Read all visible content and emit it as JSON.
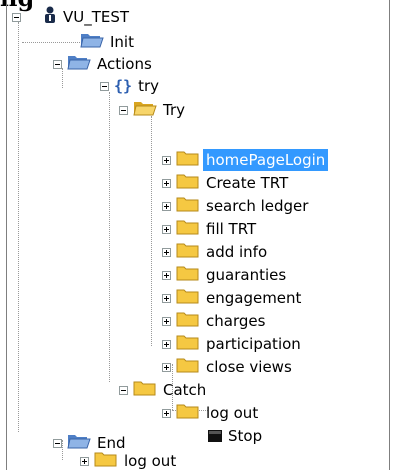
{
  "header": {
    "partial_title": "ng"
  },
  "tree": {
    "root": {
      "label": "VU_TEST",
      "icon": "user-icon"
    },
    "items": [
      {
        "label": "Init",
        "icon": "folder-open-icon"
      },
      {
        "label": "Actions",
        "icon": "folder-open-icon"
      },
      {
        "label": "try",
        "icon": "braces-icon"
      },
      {
        "label": "Try",
        "icon": "folder-open-icon"
      },
      {
        "label": "homePageLogin",
        "icon": "folder-icon",
        "selected": true
      },
      {
        "label": "Create TRT",
        "icon": "folder-icon"
      },
      {
        "label": "search ledger",
        "icon": "folder-icon"
      },
      {
        "label": "fill TRT",
        "icon": "folder-icon"
      },
      {
        "label": "add info",
        "icon": "folder-icon"
      },
      {
        "label": "guaranties",
        "icon": "folder-icon"
      },
      {
        "label": "engagement",
        "icon": "folder-icon"
      },
      {
        "label": "charges",
        "icon": "folder-icon"
      },
      {
        "label": "participation",
        "icon": "folder-icon"
      },
      {
        "label": "close views",
        "icon": "folder-icon"
      },
      {
        "label": "Catch",
        "icon": "folder-icon"
      },
      {
        "label": "log out",
        "icon": "folder-icon"
      },
      {
        "label": "Stop",
        "icon": "stop-icon"
      },
      {
        "label": "End",
        "icon": "folder-open-icon"
      },
      {
        "label": "log out",
        "icon": "folder-icon"
      }
    ]
  },
  "colors": {
    "selection": "#3399ff",
    "folder_yellow": "#f5c842",
    "folder_blue": "#6a9bd8"
  }
}
